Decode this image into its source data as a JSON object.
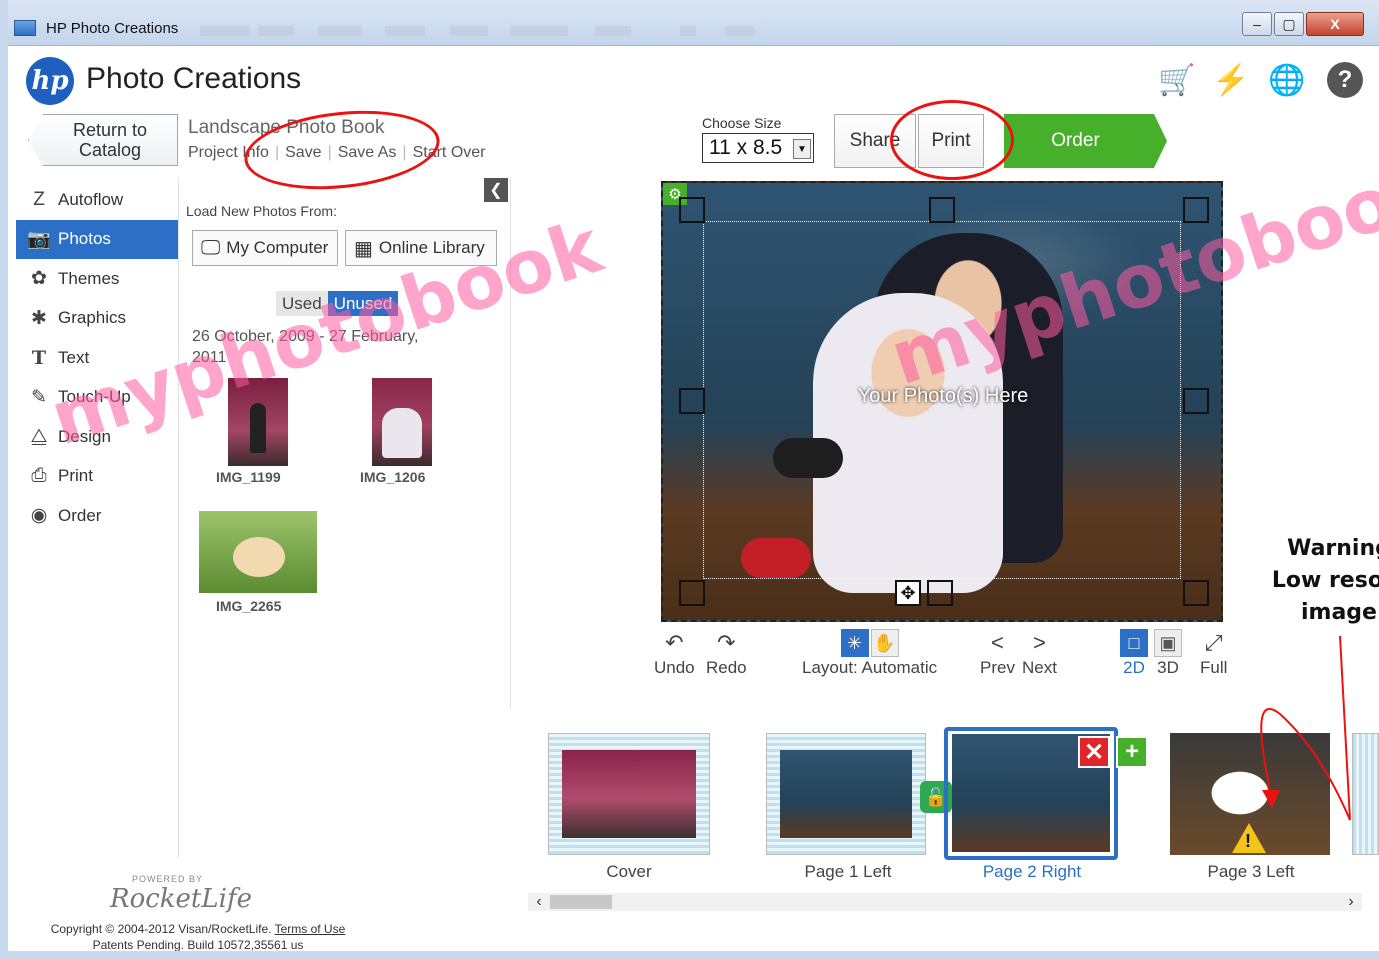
{
  "window": {
    "title": "HP Photo Creations",
    "minimize": "–",
    "maximize": "▢",
    "close": "X"
  },
  "header": {
    "logo": "hp",
    "app_title": "Photo Creations",
    "icons": [
      "cart-icon",
      "lightning-icon",
      "globe-icon",
      "help-icon"
    ]
  },
  "project": {
    "return_label": "Return to Catalog",
    "title": "Landscape Photo Book",
    "links": [
      "Project Info",
      "Save",
      "Save As",
      "Start Over"
    ]
  },
  "sidebar": {
    "items": [
      {
        "label": "Autoflow",
        "icon": "Z"
      },
      {
        "label": "Photos",
        "icon": "📷",
        "active": true
      },
      {
        "label": "Themes",
        "icon": "✿"
      },
      {
        "label": "Graphics",
        "icon": "✱"
      },
      {
        "label": "Text",
        "icon": "T"
      },
      {
        "label": "Touch-Up",
        "icon": "✎"
      },
      {
        "label": "Design",
        "icon": "⧋"
      },
      {
        "label": "Print",
        "icon": "⎙"
      },
      {
        "label": "Order",
        "icon": "◉"
      }
    ]
  },
  "photos_panel": {
    "load_label": "Load New Photos From:",
    "my_computer": "My Computer",
    "online_library": "Online Library",
    "filter_used": "Used",
    "filter_unused": "Unused",
    "date_range": "26 October, 2009 - 27 February, 2011",
    "thumbnails": [
      "IMG_1199",
      "IMG_1206",
      "IMG_2265"
    ]
  },
  "toolbar": {
    "size_label": "Choose Size",
    "size_value": "11 x 8.5",
    "share": "Share",
    "print": "Print",
    "order": "Order"
  },
  "canvas": {
    "caption": "Your Photo(s) Here"
  },
  "controls": {
    "undo": "Undo",
    "redo": "Redo",
    "layout": "Layout: Automatic",
    "prev": "Prev",
    "next": "Next",
    "view_2d": "2D",
    "view_3d": "3D",
    "full": "Full"
  },
  "annotation": {
    "warning_lines": [
      "Warning",
      "Low resolu",
      "image"
    ]
  },
  "pages": [
    "Cover",
    "Page 1 Left",
    "Page 2 Right",
    "Page 3 Left"
  ],
  "footer": {
    "powered_by": "POWERED BY",
    "brand": "RocketLife",
    "copyright": "Copyright © 2004-2012 Visan/RocketLife.",
    "terms": "Terms of Use",
    "build": "Patents Pending. Build 10572,35561 us"
  },
  "watermark": "myphotobook",
  "colors": {
    "accent": "#2b6fc7",
    "order_green": "#47b02a",
    "annotation_red": "#e11111"
  }
}
